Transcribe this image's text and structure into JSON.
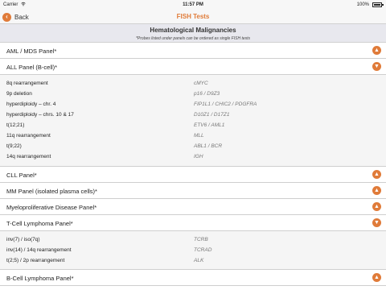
{
  "status_bar": {
    "carrier": "Carrier",
    "time": "11:57 PM",
    "battery": "100%"
  },
  "nav": {
    "back_label": "Back",
    "title": "FISH Tests"
  },
  "section": {
    "title": "Hematological Malignancies",
    "note": "*Probes listed under panels can be ordered as single FISH tests"
  },
  "panels": [
    {
      "label": "AML / MDS Panel*",
      "toggle": "up"
    },
    {
      "label": "ALL Panel (B-cell)*",
      "toggle": "down"
    },
    {
      "label": "CLL Panel*",
      "toggle": "up"
    },
    {
      "label": "MM Panel (isolated plasma cells)*",
      "toggle": "up"
    },
    {
      "label": "Myeloproliferative Disease Panel*",
      "toggle": "up"
    },
    {
      "label": "T-Cell Lymphoma Panel*",
      "toggle": "down"
    },
    {
      "label": "B-Cell Lymphoma Panel*",
      "toggle": "up"
    }
  ],
  "all_details": [
    {
      "name": "8q rearrangement",
      "gene": "cMYC"
    },
    {
      "name": "9p deletion",
      "gene": "p16 / D9Z3"
    },
    {
      "name": "hyperdiploidy – chr. 4",
      "gene": "FIP1L1 / CHIC2 / PDGFRA"
    },
    {
      "name": "hyperdiploidy – chrs. 10 & 17",
      "gene": "D10Z1 / D17Z1"
    },
    {
      "name": "t(12;21)",
      "gene": "ETV6 / AML1"
    },
    {
      "name": "11q rearrangement",
      "gene": "MLL"
    },
    {
      "name": "t(9;22)",
      "gene": "ABL1 / BCR"
    },
    {
      "name": "14q rearrangement",
      "gene": "IGH"
    }
  ],
  "tcell_details": [
    {
      "name": "inv(7) / iso(7q)",
      "gene": "TCRB"
    },
    {
      "name": "inv(14) / 14q rearrangement",
      "gene": "TCRAD"
    },
    {
      "name": "t(2;5) / 2p rearrangement",
      "gene": "ALK"
    }
  ],
  "icons": {
    "up": "▲",
    "down": "▼",
    "back": "‹"
  },
  "colors": {
    "accent": "#e07b39",
    "header_bg": "#e8e8ee"
  }
}
